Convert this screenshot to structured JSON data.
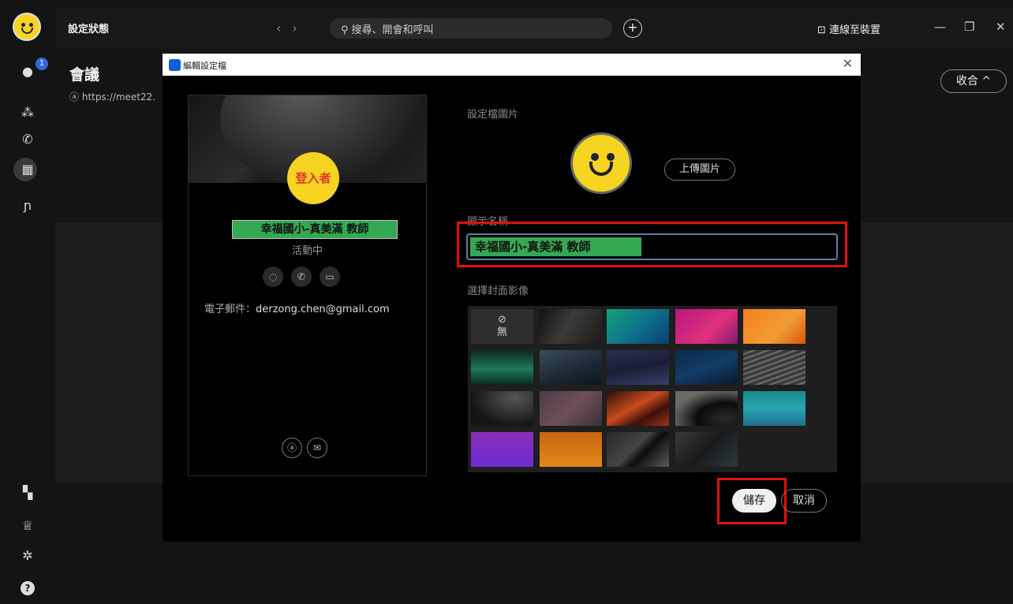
{
  "topbar": {
    "status": "設定狀態",
    "search_placeholder": "搜尋、開會和呼叫",
    "connect_label": "連線至裝置"
  },
  "sidebar": {
    "badge_count": "1",
    "items": [
      {
        "icon": "chat-icon"
      },
      {
        "icon": "people-icon"
      },
      {
        "icon": "phone-icon"
      },
      {
        "icon": "calendar-icon"
      },
      {
        "icon": "routes-icon"
      },
      {
        "icon": "apps-icon"
      },
      {
        "icon": "crown-icon"
      },
      {
        "icon": "gear-icon"
      },
      {
        "icon": "help-icon"
      }
    ]
  },
  "page": {
    "title": "會議",
    "url": "https://meet22.",
    "collapse_label": "收合"
  },
  "dialog": {
    "title": "編輯設定檔",
    "card": {
      "avatar_text": "登入者",
      "name": "幸福國小-真美滿 教師",
      "status": "活動中",
      "email_label": "電子郵件：",
      "email_value": "derzong.chen@gmail.com"
    },
    "profile_picture_label": "設定檔圖片",
    "upload_label": "上傳圖片",
    "display_name_label": "顯示名稱",
    "display_name_value": "幸福國小-真美滿 教師",
    "cover_label": "選擇封面影像",
    "cover_none_label": "無",
    "save_label": "儲存",
    "cancel_label": "取消"
  },
  "colors": {
    "highlight_green": "#34a853",
    "annotation_red": "#e01010",
    "avatar_yellow": "#f5d422"
  }
}
